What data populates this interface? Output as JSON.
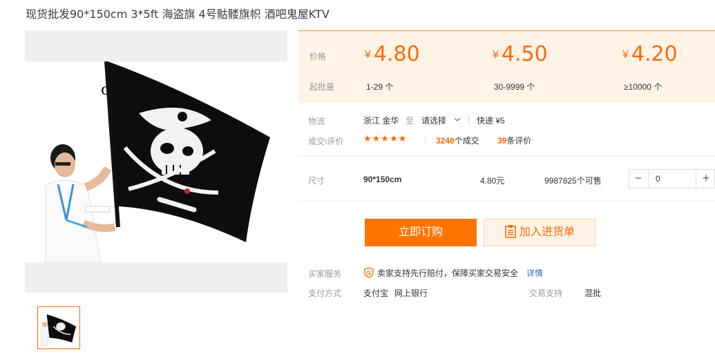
{
  "title": "现货批发90*150cm 3*5ft 海盗旗 4号骷髅旗帜 酒吧鬼屋KTV",
  "prices": {
    "price_label": "价格",
    "moq_label": "起批量",
    "currency": "¥",
    "tiers": [
      {
        "price": "4.80",
        "range": "1-29 个"
      },
      {
        "price": "4.50",
        "range": "30-9999 个"
      },
      {
        "price": "4.20",
        "range": "≥10000 个"
      }
    ]
  },
  "logistics": {
    "label": "物流",
    "origin": "浙江 金华",
    "to": "至",
    "dest_select": "请选择",
    "divider": "|",
    "shipping": "快递 ¥5"
  },
  "deals": {
    "label": "成交\\评价",
    "stars": "★★★★★",
    "sold_count": "3248",
    "sold_suffix": "个成交",
    "review_count": "39",
    "review_suffix": "条评价"
  },
  "sku": {
    "label": "尺寸",
    "name": "90*150cm",
    "price": "4.80元",
    "stock": "9987825个可售",
    "quantity": "0"
  },
  "actions": {
    "buy_now": "立即订购",
    "add_cart": "加入进货单"
  },
  "service": {
    "label": "买家服务",
    "badge": "保",
    "text": "卖家支持先行赔付，保障买家交易安全",
    "link": "详情"
  },
  "payment": {
    "label": "支付方式",
    "methods": [
      "支付宝",
      "网上银行"
    ],
    "trade_label": "交易支持",
    "trade_value": "混批"
  },
  "colors": {
    "accent": "#ff6a00",
    "button": "#ff7300",
    "price_bg": "#fff3e8"
  }
}
